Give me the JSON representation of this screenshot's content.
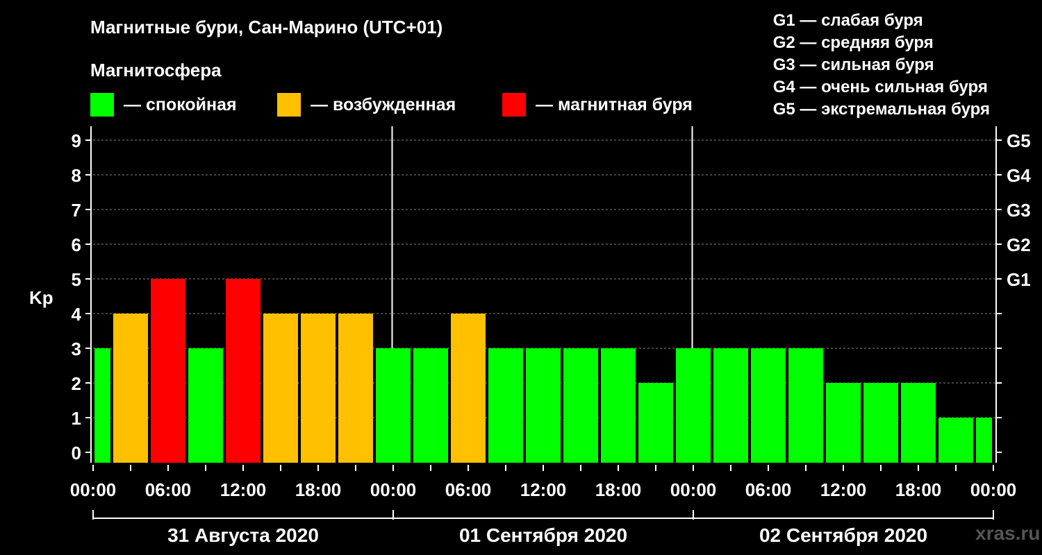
{
  "header": {
    "title": "Магнитные бури, Сан-Марино (UTC+01)",
    "subtitle": "Магнитосфера"
  },
  "legend": [
    {
      "label": "— спокойная",
      "color": "#00ff00"
    },
    {
      "label": "— возбужденная",
      "color": "#ffc000"
    },
    {
      "label": "— магнитная буря",
      "color": "#ff0000"
    }
  ],
  "g_levels": [
    "G1 — слабая буря",
    "G2 — средняя буря",
    "G3 — сильная буря",
    "G4 — очень сильная буря",
    "G5 — экстремальная буря"
  ],
  "watermark": "xras.ru",
  "chart_data": {
    "type": "bar",
    "ylabel": "Kp",
    "ylim": [
      0,
      9
    ],
    "y_ticks": [
      0,
      1,
      2,
      3,
      4,
      5,
      6,
      7,
      8,
      9
    ],
    "right_ticks": [
      {
        "value": 5,
        "label": "G1"
      },
      {
        "value": 6,
        "label": "G2"
      },
      {
        "value": 7,
        "label": "G3"
      },
      {
        "value": 8,
        "label": "G4"
      },
      {
        "value": 9,
        "label": "G5"
      }
    ],
    "x_tick_labels": [
      "00:00",
      "06:00",
      "12:00",
      "18:00",
      "00:00",
      "06:00",
      "12:00",
      "18:00",
      "00:00",
      "06:00",
      "12:00",
      "18:00",
      "00:00"
    ],
    "days": [
      "31 Августа 2020",
      "01 Сентября 2020",
      "02 Сентября 2020"
    ],
    "interval_hours": 3,
    "values": [
      3,
      4,
      5,
      3,
      5,
      4,
      4,
      4,
      3,
      3,
      4,
      3,
      3,
      3,
      3,
      2,
      3,
      3,
      3,
      3,
      2,
      2,
      2,
      1,
      1
    ],
    "statuses": [
      "quiet",
      "excited",
      "storm",
      "quiet",
      "storm",
      "excited",
      "excited",
      "excited",
      "quiet",
      "quiet",
      "excited",
      "quiet",
      "quiet",
      "quiet",
      "quiet",
      "quiet",
      "quiet",
      "quiet",
      "quiet",
      "quiet",
      "quiet",
      "quiet",
      "quiet",
      "quiet",
      "quiet"
    ],
    "status_colors": {
      "quiet": "#00ff00",
      "excited": "#ffc000",
      "storm": "#ff0000"
    },
    "grid": "dashed horizontal",
    "legend_position": "top"
  }
}
